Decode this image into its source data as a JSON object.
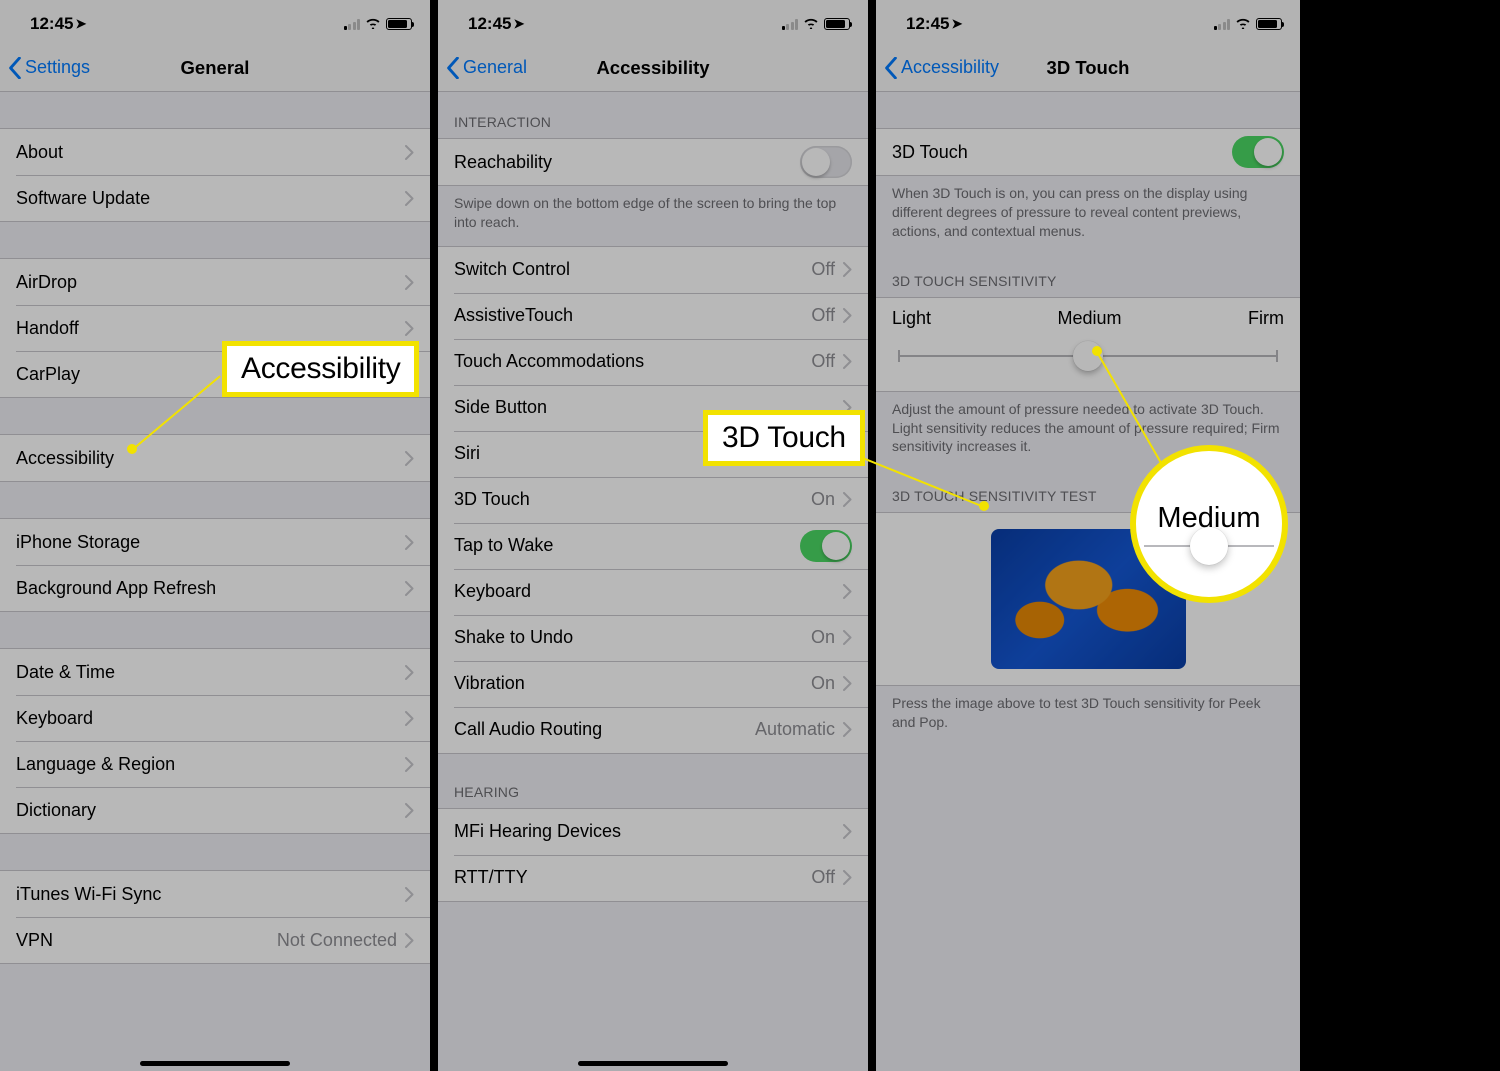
{
  "status": {
    "time": "12:45",
    "loc_glyph": "➤"
  },
  "screen1": {
    "back": "Settings",
    "title": "General",
    "groups": [
      [
        {
          "label": "About",
          "detail": "",
          "chev": true
        },
        {
          "label": "Software Update",
          "detail": "",
          "chev": true
        }
      ],
      [
        {
          "label": "AirDrop",
          "detail": "",
          "chev": true
        },
        {
          "label": "Handoff",
          "detail": "",
          "chev": true
        },
        {
          "label": "CarPlay",
          "detail": "",
          "chev": true
        }
      ],
      [
        {
          "label": "Accessibility",
          "detail": "",
          "chev": true
        }
      ],
      [
        {
          "label": "iPhone Storage",
          "detail": "",
          "chev": true
        },
        {
          "label": "Background App Refresh",
          "detail": "",
          "chev": true
        }
      ],
      [
        {
          "label": "Date & Time",
          "detail": "",
          "chev": true
        },
        {
          "label": "Keyboard",
          "detail": "",
          "chev": true
        },
        {
          "label": "Language & Region",
          "detail": "",
          "chev": true
        },
        {
          "label": "Dictionary",
          "detail": "",
          "chev": true
        }
      ],
      [
        {
          "label": "iTunes Wi-Fi Sync",
          "detail": "",
          "chev": true
        },
        {
          "label": "VPN",
          "detail": "Not Connected",
          "chev": true
        }
      ]
    ]
  },
  "screen2": {
    "back": "General",
    "title": "Accessibility",
    "header1": "INTERACTION",
    "reachability": "Reachability",
    "reachability_footer": "Swipe down on the bottom edge of the screen to bring the top into reach.",
    "rows": [
      {
        "label": "Switch Control",
        "detail": "Off",
        "chev": true
      },
      {
        "label": "AssistiveTouch",
        "detail": "Off",
        "chev": true
      },
      {
        "label": "Touch Accommodations",
        "detail": "Off",
        "chev": true
      },
      {
        "label": "Side Button",
        "detail": "",
        "chev": true
      },
      {
        "label": "Siri",
        "detail": "",
        "chev": true
      },
      {
        "label": "3D Touch",
        "detail": "On",
        "chev": true
      },
      {
        "label": "Tap to Wake",
        "detail": "",
        "toggle": true,
        "on": true
      },
      {
        "label": "Keyboard",
        "detail": "",
        "chev": true
      },
      {
        "label": "Shake to Undo",
        "detail": "On",
        "chev": true
      },
      {
        "label": "Vibration",
        "detail": "On",
        "chev": true
      },
      {
        "label": "Call Audio Routing",
        "detail": "Automatic",
        "chev": true
      }
    ],
    "header2": "HEARING",
    "rows2": [
      {
        "label": "MFi Hearing Devices",
        "detail": "",
        "chev": true
      },
      {
        "label": "RTT/TTY",
        "detail": "Off",
        "chev": true
      }
    ]
  },
  "screen3": {
    "back": "Accessibility",
    "title": "3D Touch",
    "toggle_label": "3D Touch",
    "toggle_desc": "When 3D Touch is on, you can press on the display using different degrees of pressure to reveal content previews, actions, and contextual menus.",
    "sens_header": "3D TOUCH SENSITIVITY",
    "slider_labels": {
      "left": "Light",
      "mid": "Medium",
      "right": "Firm"
    },
    "sens_footer": "Adjust the amount of pressure needed to activate 3D Touch. Light sensitivity reduces the amount of pressure required; Firm sensitivity increases it.",
    "test_header": "3D TOUCH SENSITIVITY TEST",
    "test_footer": "Press the image above to test 3D Touch sensitivity for Peek and Pop."
  },
  "callouts": {
    "c1": "Accessibility",
    "c2": "3D Touch",
    "c3": "Medium"
  }
}
